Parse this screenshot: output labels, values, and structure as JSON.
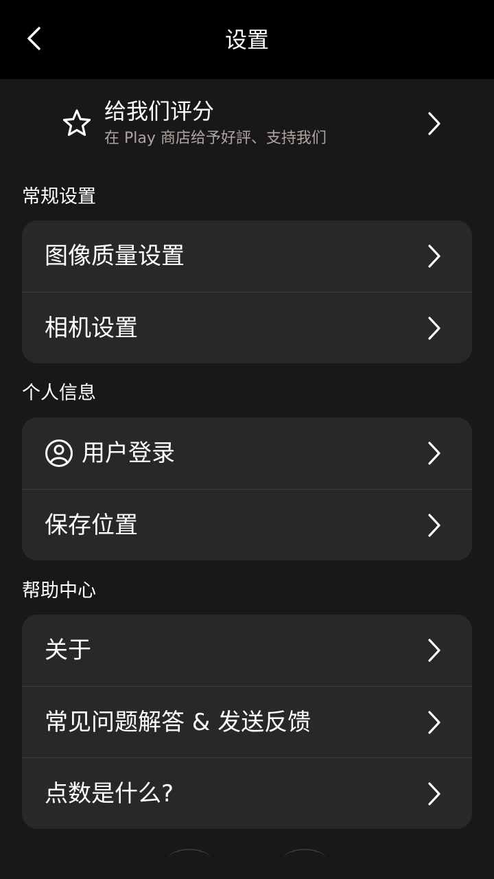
{
  "header": {
    "title": "设置"
  },
  "rate": {
    "title": "给我们评分",
    "subtitle": "在 Play 商店给予好評、支持我们"
  },
  "sections": [
    {
      "title": "常规设置",
      "items": [
        {
          "label": "图像质量设置"
        },
        {
          "label": "相机设置"
        }
      ]
    },
    {
      "title": "个人信息",
      "items": [
        {
          "label": "用户登录",
          "icon": "user-circle-icon"
        },
        {
          "label": "保存位置"
        }
      ]
    },
    {
      "title": "帮助中心",
      "items": [
        {
          "label": "关于"
        },
        {
          "label": "常见问题解答 & 发送反馈"
        },
        {
          "label": "点数是什么?"
        }
      ]
    }
  ]
}
